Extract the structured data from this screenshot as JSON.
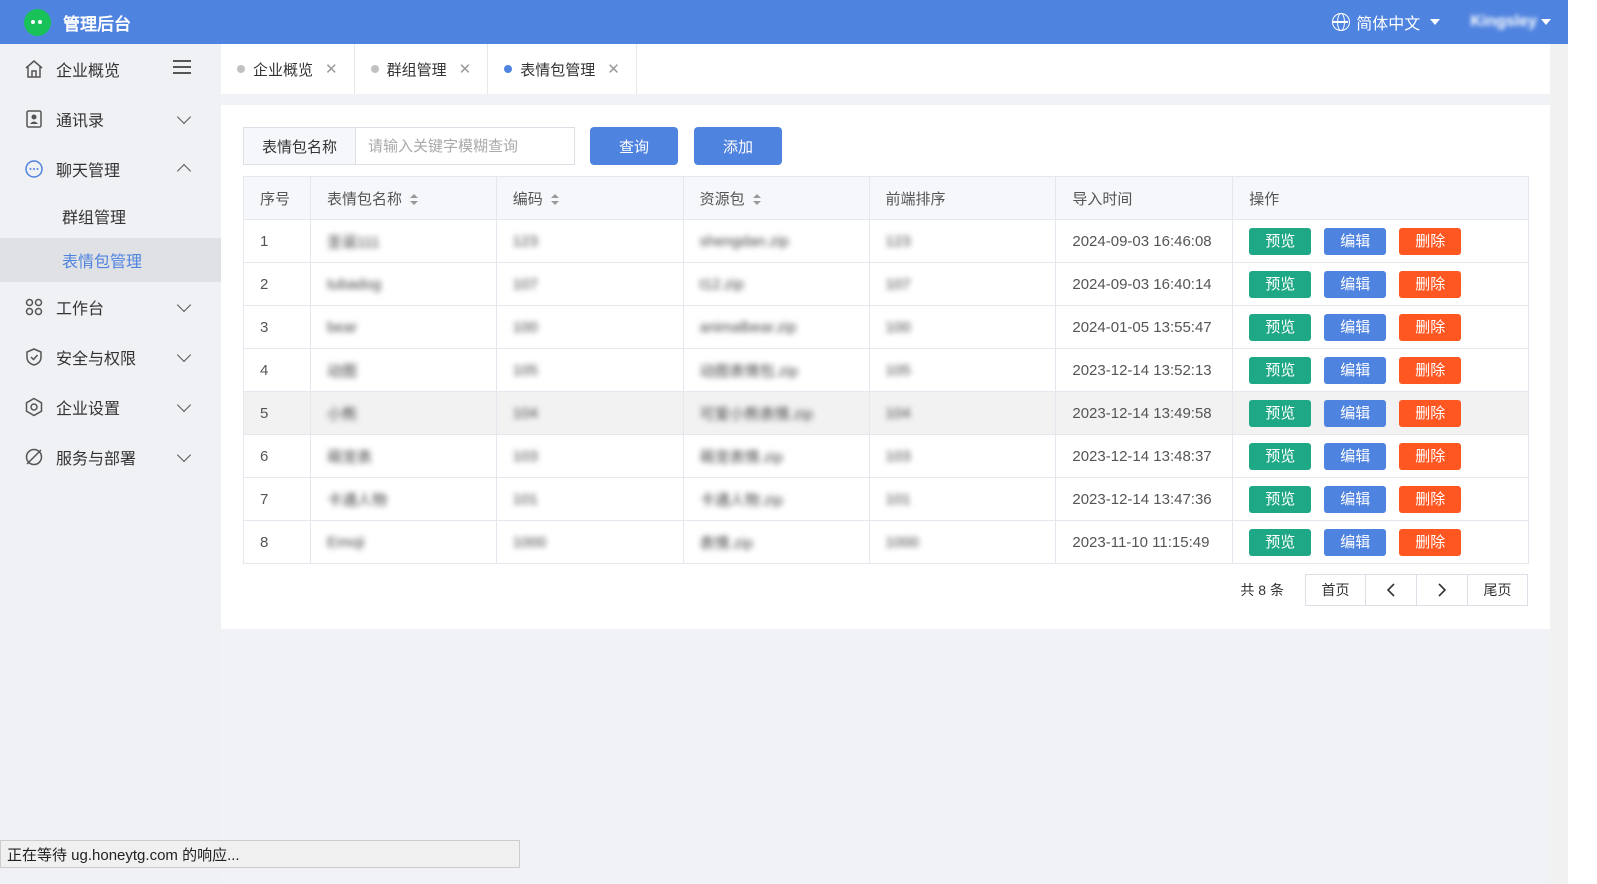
{
  "header": {
    "app_title": "管理后台",
    "language": "简体中文",
    "user": "Kingsley"
  },
  "sidebar": {
    "items": [
      {
        "label": "企业概览",
        "icon": "home-icon"
      },
      {
        "label": "通讯录",
        "icon": "contacts-icon"
      },
      {
        "label": "聊天管理",
        "icon": "chat-icon",
        "expanded": true,
        "children": [
          "群组管理",
          "表情包管理"
        ]
      },
      {
        "label": "工作台",
        "icon": "grid-icon"
      },
      {
        "label": "安全与权限",
        "icon": "shield-icon"
      },
      {
        "label": "企业设置",
        "icon": "settings-icon"
      },
      {
        "label": "服务与部署",
        "icon": "deploy-icon"
      }
    ],
    "active_child": "表情包管理"
  },
  "tabs": [
    {
      "label": "企业概览",
      "active": false
    },
    {
      "label": "群组管理",
      "active": false
    },
    {
      "label": "表情包管理",
      "active": true
    }
  ],
  "search": {
    "label": "表情包名称",
    "placeholder": "请输入关键字模糊查询",
    "query_button": "查询",
    "add_button": "添加"
  },
  "table": {
    "headers": [
      "序号",
      "表情包名称",
      "编码",
      "资源包",
      "前端排序",
      "导入时间",
      "操作"
    ],
    "actions": {
      "preview": "预览",
      "edit": "编辑",
      "delete": "删除"
    },
    "rows": [
      {
        "no": "1",
        "name": "圣诞111",
        "code": "123",
        "pkg": "shengdan.zip",
        "order": "123",
        "time": "2024-09-03 16:46:08"
      },
      {
        "no": "2",
        "name": "tubadog",
        "code": "107",
        "pkg": "t12.zip",
        "order": "107",
        "time": "2024-09-03 16:40:14"
      },
      {
        "no": "3",
        "name": "bear",
        "code": "100",
        "pkg": "animalbear.zip",
        "order": "100",
        "time": "2024-01-05 13:55:47"
      },
      {
        "no": "4",
        "name": "动图",
        "code": "105",
        "pkg": "动图表情包.zip",
        "order": "105",
        "time": "2023-12-14 13:52:13"
      },
      {
        "no": "5",
        "name": "小熊",
        "code": "104",
        "pkg": "可爱小熊表情.zip",
        "order": "104",
        "time": "2023-12-14 13:49:58"
      },
      {
        "no": "6",
        "name": "萌宠表",
        "code": "103",
        "pkg": "萌宠表情.zip",
        "order": "103",
        "time": "2023-12-14 13:48:37"
      },
      {
        "no": "7",
        "name": "卡通人物",
        "code": "101",
        "pkg": "卡通人物.zip",
        "order": "101",
        "time": "2023-12-14 13:47:36"
      },
      {
        "no": "8",
        "name": "Emoji",
        "code": "1000",
        "pkg": "表情.zip",
        "order": "1000",
        "time": "2023-11-10 11:15:49"
      }
    ]
  },
  "pagination": {
    "total": "共 8 条",
    "first": "首页",
    "prev": "<",
    "next": ">",
    "last": "尾页"
  },
  "status_bar": "正在等待 ug.honeytg.com 的响应...",
  "colors": {
    "header": "#4f83e0",
    "preview": "#1fa885",
    "edit": "#4f83e0",
    "delete": "#ff5722"
  }
}
